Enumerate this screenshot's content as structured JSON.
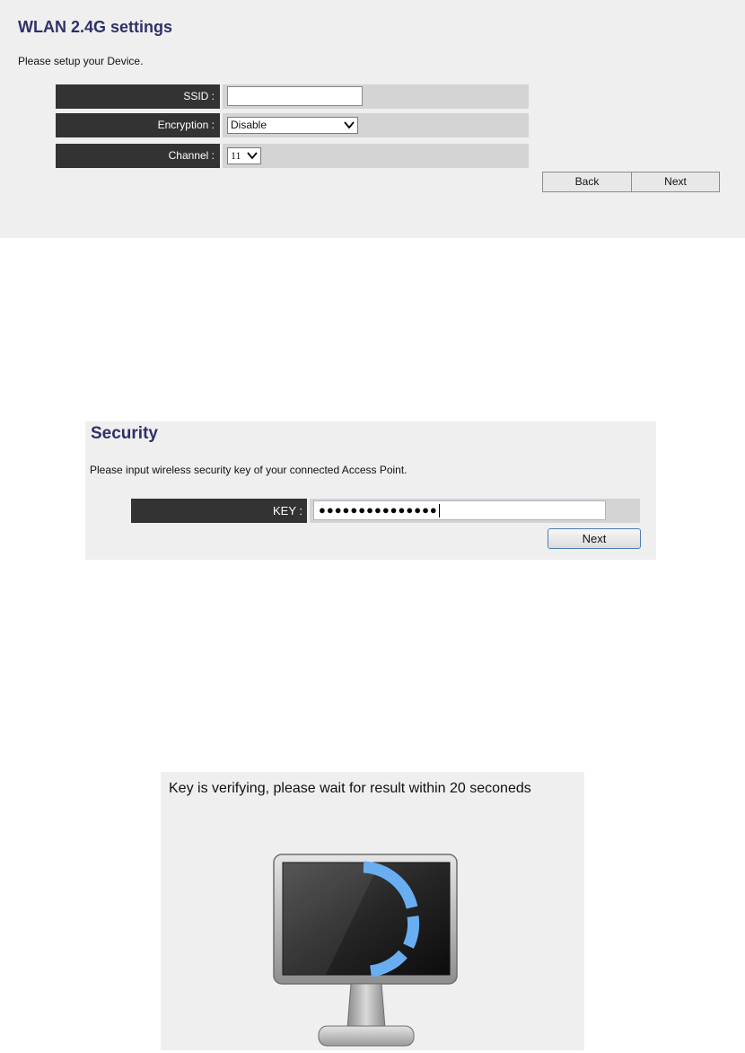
{
  "wlan": {
    "title": "WLAN 2.4G settings",
    "subtitle": "Please setup your Device.",
    "fields": {
      "ssid_label": "SSID :",
      "ssid_value": "",
      "encryption_label": "Encryption :",
      "encryption_selected": "Disable",
      "channel_label": "Channel :",
      "channel_selected": "11"
    },
    "buttons": {
      "back": "Back",
      "next": "Next"
    }
  },
  "security": {
    "title": "Security",
    "subtitle": "Please input wireless security key of your connected Access Point.",
    "key_label": "KEY :",
    "key_masked": "●●●●●●●●●●●●●●●",
    "next": "Next"
  },
  "verify": {
    "message": "Key is verifying, please wait for result within 20 seconeds",
    "icon": "monitor-loading-icon"
  },
  "colors": {
    "heading": "#2f3168",
    "label_bg": "#333333",
    "field_bg": "#d4d4d4",
    "panel_bg": "#efefef",
    "spinner": "#6aaef2"
  }
}
